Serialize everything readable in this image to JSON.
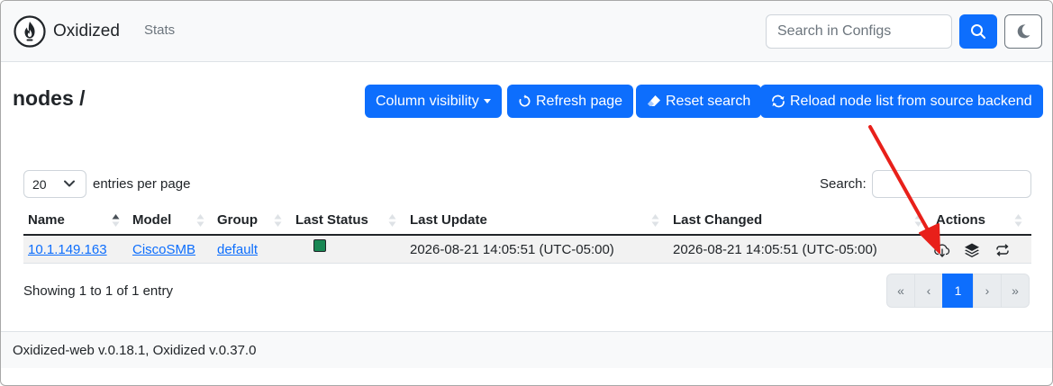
{
  "app": {
    "brand": "Oxidized",
    "nav_stats": "Stats"
  },
  "header_search": {
    "placeholder": "Search in Configs"
  },
  "icons": {
    "logo": "oxidized-flame-logo",
    "search": "search-icon",
    "dark_mode": "moon-icon",
    "refresh": "refresh-icon",
    "reset": "eraser-icon",
    "reload": "reload-icon",
    "fetch": "cloud-download-icon",
    "versions": "layers-icon",
    "refresh_node": "repeat-icon"
  },
  "page": {
    "title": "nodes /"
  },
  "toolbar": {
    "column_visibility": "Column visibility",
    "refresh_page": "Refresh page",
    "reset_search": "Reset search",
    "reload_nodes": "Reload node list from source backend"
  },
  "table_controls": {
    "per_page_value": "20",
    "per_page_label": "entries per page",
    "search_label": "Search:"
  },
  "table": {
    "columns": [
      "Name",
      "Model",
      "Group",
      "Last Status",
      "Last Update",
      "Last Changed",
      "Actions"
    ],
    "rows": [
      {
        "name": "10.1.149.163",
        "model": "CiscoSMB",
        "group": "default",
        "last_status": "success",
        "last_update": "2026-08-21 14:05:51 (UTC-05:00)",
        "last_changed": "2026-08-21 14:05:51 (UTC-05:00)"
      }
    ]
  },
  "status_color": "#198754",
  "accent_color": "#0d6efd",
  "pagination": {
    "showing": "Showing 1 to 1 of 1 entry",
    "first": "«",
    "prev": "‹",
    "current": "1",
    "next": "›",
    "last": "»"
  },
  "footer": {
    "text": "Oxidized-web v.0.18.1, Oxidized v.0.37.0"
  }
}
